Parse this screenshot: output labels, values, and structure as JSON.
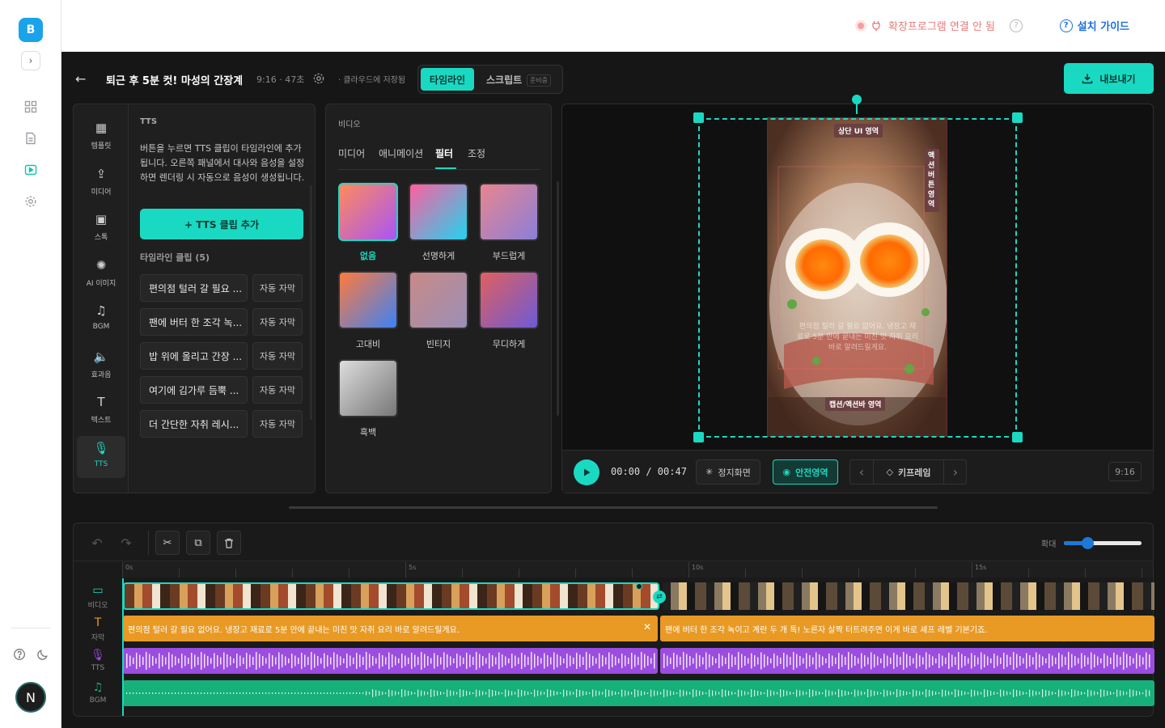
{
  "app": {
    "logo_letter": "B",
    "avatar_letter": "N"
  },
  "topbar": {
    "ext_status": "확장프로그램 연결 안 됨",
    "guide": "설치 가이드"
  },
  "header": {
    "back": "←",
    "title": "퇴근 후 5분 컷! 마성의 간장계란밥",
    "meta": "9:16 · 47초",
    "saved": "· 클라우드에 저장됨",
    "tab_timeline": "타임라인",
    "tab_script": "스크립트",
    "script_badge": "준비중",
    "export": "내보내기"
  },
  "sidebar": {
    "items": [
      {
        "label": "템플릿",
        "icon": "grid-icon"
      },
      {
        "label": "미디어",
        "icon": "upload-icon"
      },
      {
        "label": "스톡",
        "icon": "image-icon"
      },
      {
        "label": "AI 이미지",
        "icon": "sparkle-icon"
      },
      {
        "label": "BGM",
        "icon": "music-icon"
      },
      {
        "label": "효과음",
        "icon": "speaker-icon"
      },
      {
        "label": "텍스트",
        "icon": "text-icon"
      },
      {
        "label": "TTS",
        "icon": "mic-icon"
      }
    ]
  },
  "tts": {
    "heading": "TTS",
    "desc": "버튼을 누르면 TTS 클립이 타임라인에 추가됩니다. 오른쪽 패널에서 대사와 음성을 설정하면 렌더링 시 자동으로 음성이 생성됩니다.",
    "add": "+ TTS 클립 추가",
    "clips_heading": "타임라인 클립 (5)",
    "auto": "자동 자막",
    "clips": [
      "편의점 털러 갈 필요 ...",
      "팬에 버터 한 조각 녹...",
      "밥 위에 올리고 간장 ...",
      "여기에 김가루 듬뿍 ...",
      "더 간단한 자취 레시..."
    ]
  },
  "video_panel": {
    "heading": "비디오",
    "tabs": [
      "미디어",
      "애니메이션",
      "필터",
      "조정"
    ],
    "active_tab": "필터",
    "filters": [
      {
        "name": "없음",
        "colors": [
          "#ff8a5c",
          "#a855f7"
        ]
      },
      {
        "name": "선명하게",
        "colors": [
          "#ff5fa2",
          "#22d3ee"
        ]
      },
      {
        "name": "부드럽게",
        "colors": [
          "#e8858f",
          "#8b7fd9"
        ]
      },
      {
        "name": "고대비",
        "colors": [
          "#ff7a3d",
          "#3b82f6"
        ]
      },
      {
        "name": "빈티지",
        "colors": [
          "#c98a86",
          "#9a8fb8"
        ]
      },
      {
        "name": "무디하게",
        "colors": [
          "#e0605e",
          "#6d5ad6"
        ]
      },
      {
        "name": "흑백",
        "colors": [
          "#dddddd",
          "#777777"
        ]
      }
    ]
  },
  "preview": {
    "top_ui": "상단 UI 영역",
    "action": "액션버튼영역",
    "caption_area": "캡션/액션바 영역",
    "overlay_text": "편의점 털러 갈 필요 없어요. 냉장고 재료로 5분 만에 끝내는 미친 맛 자취 요리 바로 알려드릴게요."
  },
  "player": {
    "time": "00:00 / 00:47",
    "still": "정지화면",
    "safe": "안전영역",
    "keyframe": "키프레임",
    "prev": "‹",
    "next": "›",
    "ratio": "9:16"
  },
  "timeline": {
    "zoom_label": "확대",
    "zoom": 0.3,
    "ticks": [
      "0s",
      "5s",
      "10s",
      "15s"
    ],
    "tracks": [
      "비디오",
      "자막",
      "TTS",
      "BGM"
    ],
    "captions": [
      "편의점 털러 갈 필요 없어요. 냉장고 재료로 5분 만에 끝내는 미친 맛 자취 요리 바로 알려드릴게요.",
      "팬에 버터 한 조각 녹이고 계란 두 개 톡! 노른자 살짝 터트려주면 이게 바로 셰프 레벨 기본기죠."
    ]
  },
  "colors": {
    "accent": "#1ad9c2",
    "caption": "#e89a25",
    "tts": "#9b4de0",
    "bgm": "#18b07a"
  }
}
